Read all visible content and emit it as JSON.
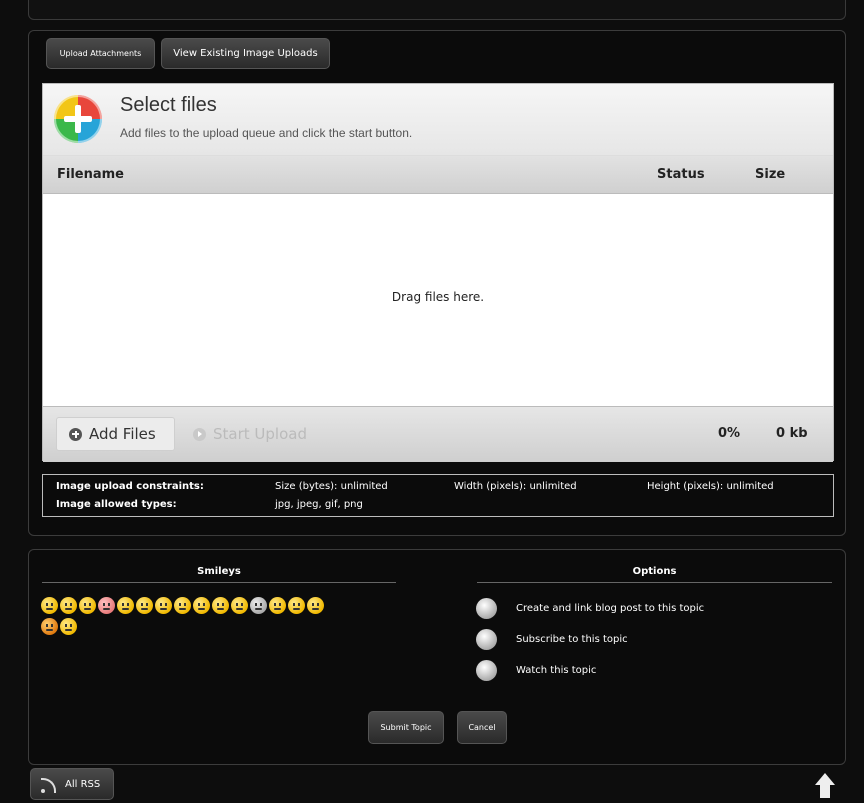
{
  "tabs": {
    "upload_attachments": "Upload Attachments",
    "view_existing": "View Existing Image Uploads"
  },
  "uploader": {
    "title": "Select files",
    "subtitle": "Add files to the upload queue and click the start button.",
    "columns": {
      "filename": "Filename",
      "status": "Status",
      "size": "Size"
    },
    "drop_text": "Drag files here.",
    "add_files": "Add Files",
    "start_upload": "Start Upload",
    "progress": "0%",
    "total_size": "0 kb"
  },
  "constraints": {
    "upload_label": "Image upload constraints:",
    "size": "Size (bytes):  unlimited",
    "width": "Width (pixels):  unlimited",
    "height": "Height (pixels):  unlimited",
    "types_label": "Image allowed types:",
    "types": "jpg, jpeg, gif, png"
  },
  "smileys": {
    "heading": "Smileys"
  },
  "options": {
    "heading": "Options",
    "items": [
      "Create and link blog post to this topic",
      "Subscribe to this topic",
      "Watch this topic"
    ]
  },
  "actions": {
    "submit": "Submit Topic",
    "cancel": "Cancel"
  },
  "footer": {
    "rss": "All RSS"
  }
}
